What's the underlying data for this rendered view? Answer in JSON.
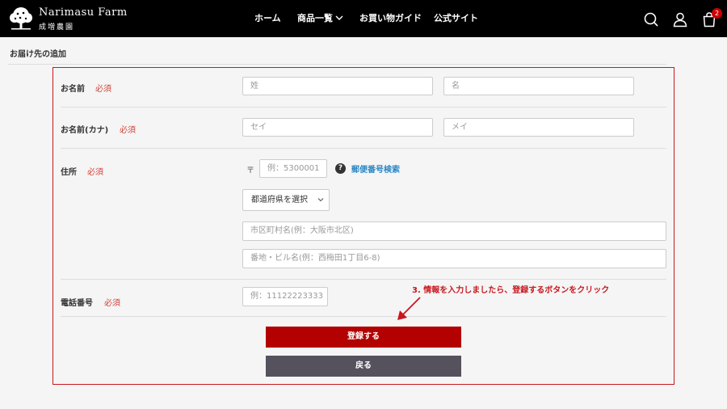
{
  "header": {
    "brand_name": "Narimasu Farm",
    "brand_sub": "成増農園",
    "nav": [
      {
        "label": "ホーム"
      },
      {
        "label": "商品一覧"
      },
      {
        "label": "お買い物ガイド"
      },
      {
        "label": "公式サイト"
      }
    ],
    "cart_count": "2",
    "icons": [
      "search-icon",
      "user-icon",
      "cart-icon",
      "chevron-down-icon"
    ]
  },
  "page": {
    "title": "お届け先の追加"
  },
  "form": {
    "name": {
      "label": "お名前",
      "required": "必須",
      "last_placeholder": "姓",
      "first_placeholder": "名"
    },
    "kana": {
      "label": "お名前(カナ)",
      "required": "必須",
      "last_placeholder": "セイ",
      "first_placeholder": "メイ"
    },
    "address": {
      "label": "住所",
      "required": "必須",
      "postal_mark": "〒",
      "postal_placeholder": "例：5300001",
      "zip_search_link": "郵便番号検索",
      "prefecture_select": "都道府県を選択",
      "city_placeholder": "市区町村名(例：大阪市北区)",
      "street_placeholder": "番地・ビル名(例：西梅田1丁目6-8)"
    },
    "phone": {
      "label": "電話番号",
      "required": "必須",
      "placeholder": "例：11122223333"
    }
  },
  "annotation": "3. 情報を入力しましたら、登録するボタンをクリック",
  "buttons": {
    "submit": "登録する",
    "back": "戻る"
  },
  "colors": {
    "header_bg": "#000000",
    "accent_red": "#b30000",
    "required_red": "#d0443c",
    "link_blue": "#2b87c4",
    "back_button": "#55525e",
    "highlight_border": "#c8171e"
  }
}
